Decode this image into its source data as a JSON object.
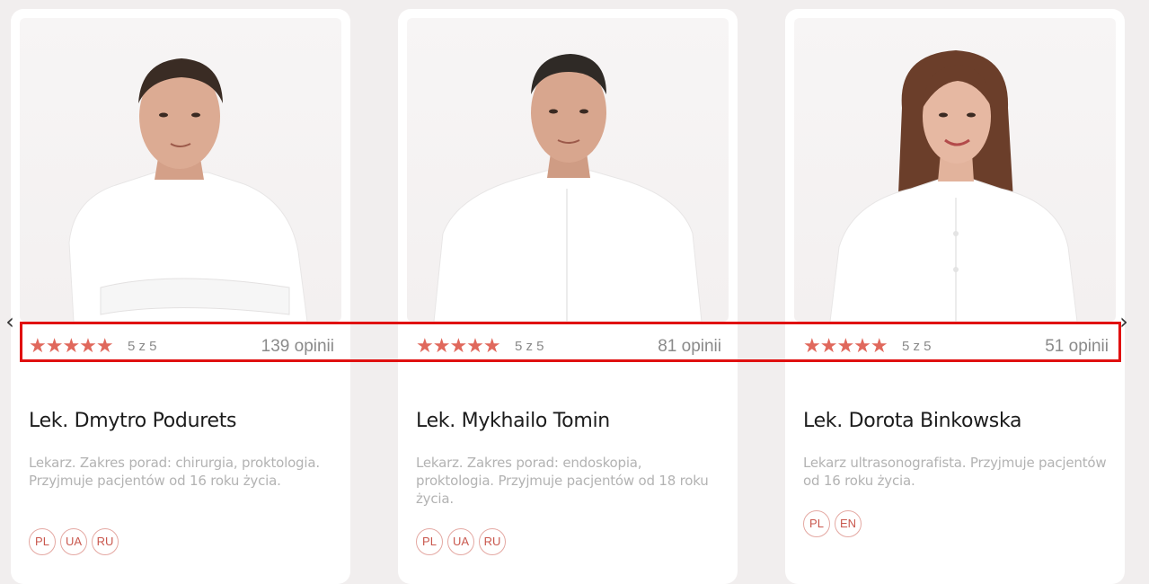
{
  "nav": {
    "prev_icon": "chevron-left-icon",
    "next_icon": "chevron-right-icon",
    "prev_glyph": "‹",
    "next_glyph": "›"
  },
  "colors": {
    "star": "#e0685c",
    "badge_text": "#c9574d",
    "badge_border": "#e4a8a2",
    "highlight": "#e01010"
  },
  "doctors": [
    {
      "name": "Lek. Dmytro Podurets",
      "stars": "★★★★★",
      "score": "5 z 5",
      "reviews": "139 opinii",
      "description": "Lekarz. Zakres porad: chirurgia, proktologia. Przyjmuje pacjentów od 16 roku życia.",
      "languages": [
        "PL",
        "UA",
        "RU"
      ]
    },
    {
      "name": "Lek. Mykhailo Tomin",
      "stars": "★★★★★",
      "score": "5 z 5",
      "reviews": "81 opinii",
      "description": "Lekarz. Zakres porad: endoskopia, proktologia. Przyjmuje pacjentów od 18 roku życia.",
      "languages": [
        "PL",
        "UA",
        "RU"
      ]
    },
    {
      "name": "Lek. Dorota Binkowska",
      "stars": "★★★★★",
      "score": "5 z 5",
      "reviews": "51 opinii",
      "description": "Lekarz ultrasonografista. Przyjmuje pacjentów od 16 roku życia.",
      "languages": [
        "PL",
        "EN"
      ]
    }
  ]
}
